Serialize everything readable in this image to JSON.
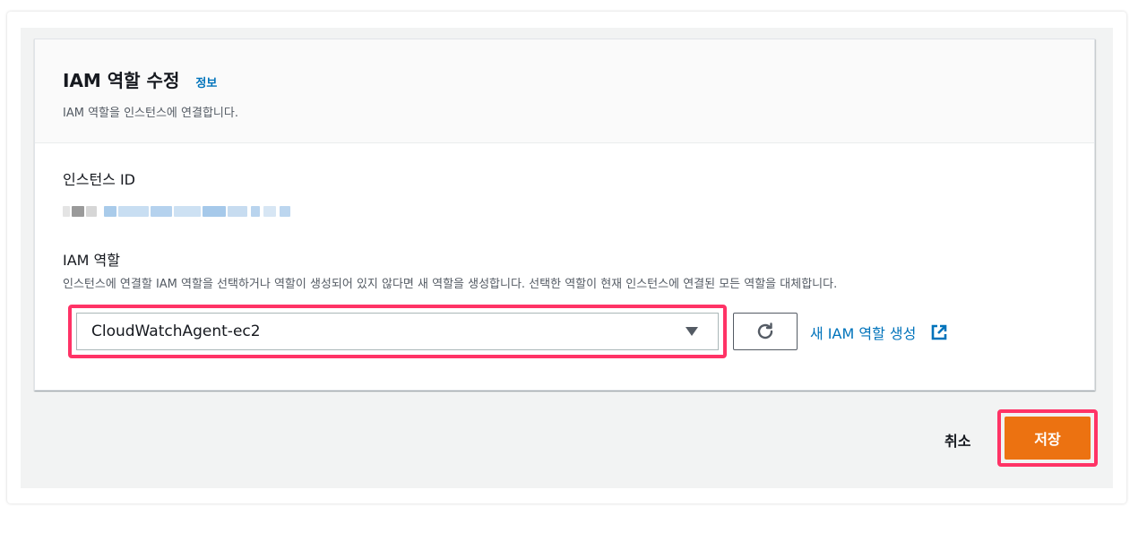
{
  "panel": {
    "title": "IAM 역할 수정",
    "info_link": "정보",
    "subtitle": "IAM 역할을 인스턴스에 연결합니다."
  },
  "instance": {
    "label": "인스턴스 ID"
  },
  "iam_role": {
    "label": "IAM 역할",
    "description": "인스턴스에 연결할 IAM 역할을 선택하거나 역할이 생성되어 있지 않다면 새 역할을 생성합니다. 선택한 역할이 현재 인스턴스에 연결된 모든 역할을 대체합니다.",
    "selected_value": "CloudWatchAgent-ec2",
    "new_role_link": "새 IAM 역할 생성",
    "dropdown_icon": "caret-down-icon",
    "refresh_icon": "refresh-icon",
    "external_icon": "external-link-icon"
  },
  "footer": {
    "cancel_label": "취소",
    "save_label": "저장"
  },
  "colors": {
    "accent_link": "#0073bb",
    "primary_button": "#ec7211",
    "highlight": "#ff3366"
  }
}
